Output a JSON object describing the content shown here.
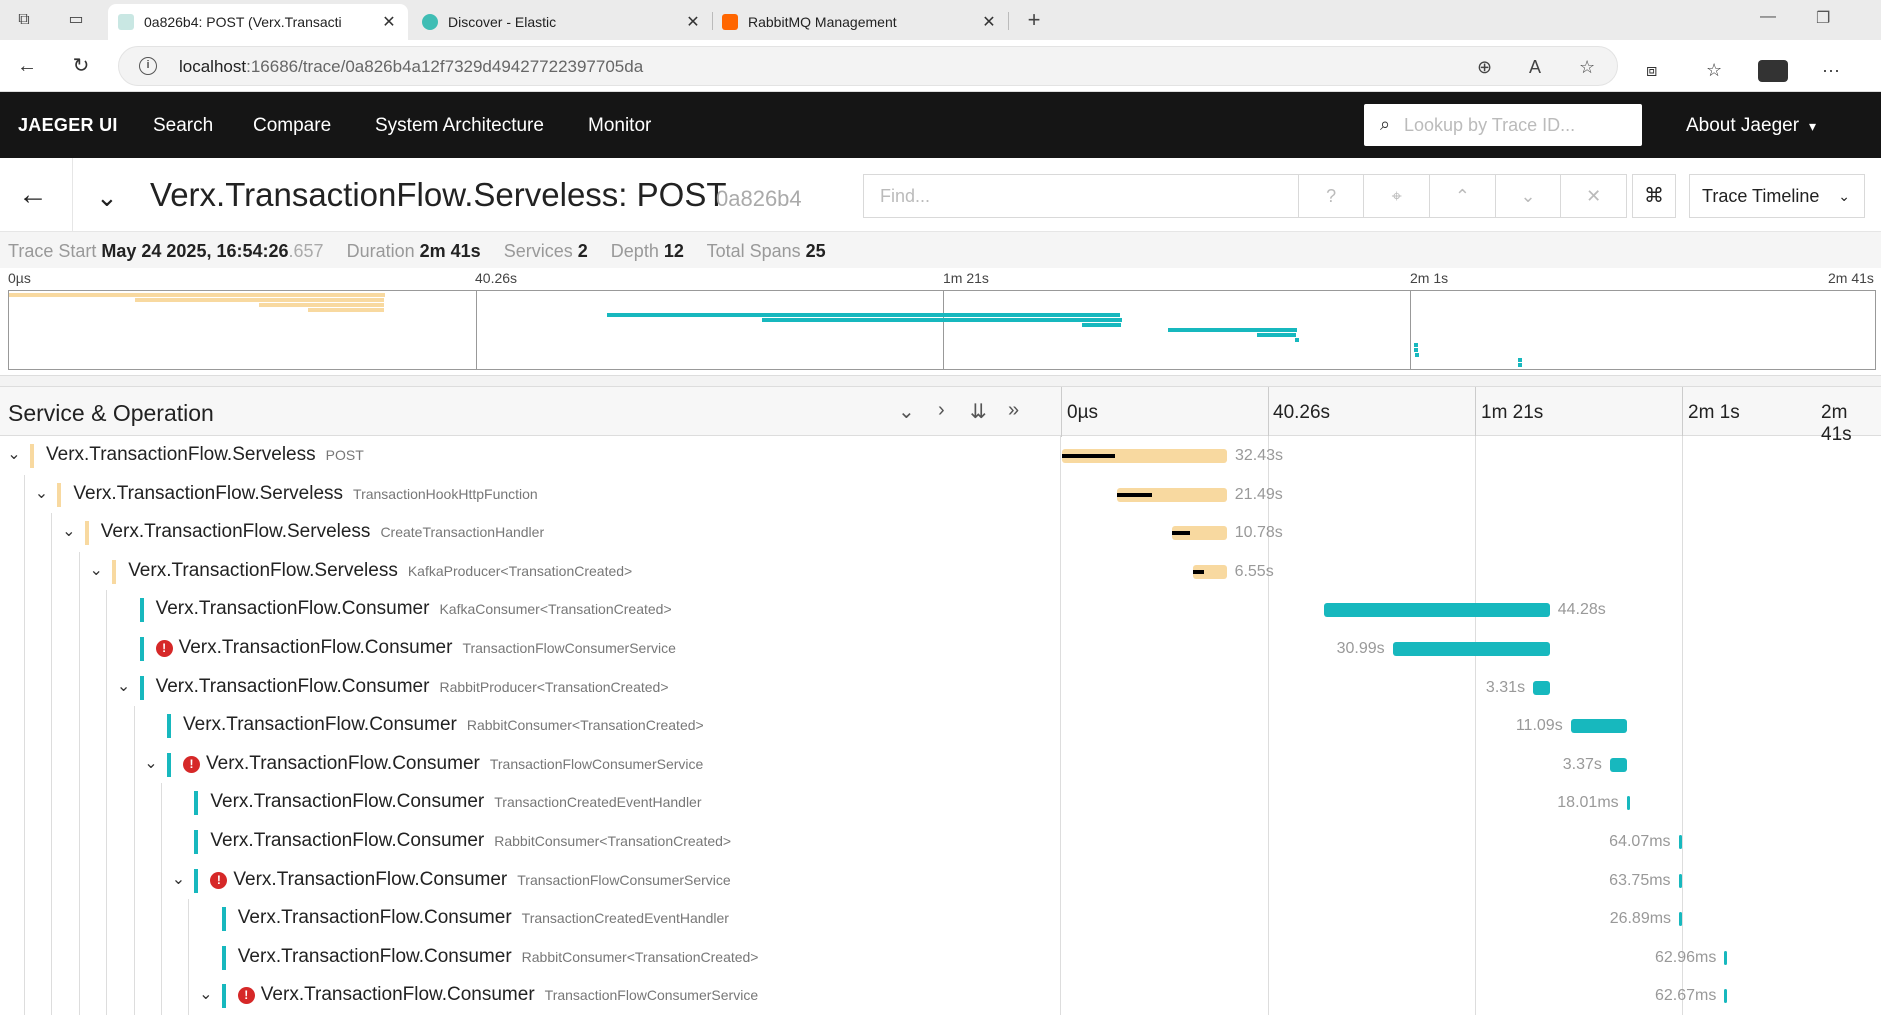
{
  "browser": {
    "tabs": [
      {
        "title": "0a826b4: POST (Verx.Transacti",
        "active": true,
        "color": "#c2185b"
      },
      {
        "title": "Discover - Elastic",
        "active": false,
        "color": "#3fbdb4"
      },
      {
        "title": "RabbitMQ Management",
        "active": false,
        "color": "#ff6600"
      }
    ],
    "url_host": "localhost",
    "url_path": ":16686/trace/0a826b4a12f7329d49427722397705da"
  },
  "jaeger_nav": {
    "brand": "JAEGER UI",
    "items": [
      "Search",
      "Compare",
      "System Architecture",
      "Monitor"
    ],
    "search_placeholder": "Lookup by Trace ID...",
    "about": "About Jaeger"
  },
  "trace": {
    "title": "Verx.TransactionFlow.Serveless: POST",
    "id_short": "0a826b4",
    "find_placeholder": "Find...",
    "view_select": "Trace Timeline",
    "summary": {
      "start_label": "Trace Start",
      "start_value": "May 24 2025, 16:54:26",
      "start_ms": ".657",
      "duration_label": "Duration",
      "duration_value": "2m 41s",
      "services_label": "Services",
      "services_value": "2",
      "depth_label": "Depth",
      "depth_value": "12",
      "spans_label": "Total Spans",
      "spans_value": "25"
    }
  },
  "minimap": {
    "ticks": [
      "0µs",
      "40.26s",
      "1m 21s",
      "2m 1s",
      "2m 41s"
    ]
  },
  "grid": {
    "column_header": "Service & Operation",
    "ticks": [
      "0µs",
      "40.26s",
      "1m 21s",
      "2m 1s",
      "2m 41s"
    ]
  },
  "colors": {
    "serveless": "#f8d9a0",
    "consumer": "#17b8be",
    "error": "#d62828"
  },
  "spans": [
    {
      "service": "Verx.TransactionFlow.Serveless",
      "operation": "POST",
      "depth": 0,
      "expandable": true,
      "error": false,
      "svc": "serveless",
      "start_s": 0.0,
      "dur_s": 32.43,
      "duration": "32.43s",
      "label_side": "right"
    },
    {
      "service": "Verx.TransactionFlow.Serveless",
      "operation": "TransactionHookHttpFunction",
      "depth": 1,
      "expandable": true,
      "error": false,
      "svc": "serveless",
      "start_s": 10.9,
      "dur_s": 21.49,
      "duration": "21.49s",
      "label_side": "right"
    },
    {
      "service": "Verx.TransactionFlow.Serveless",
      "operation": "CreateTransactionHandler",
      "depth": 2,
      "expandable": true,
      "error": false,
      "svc": "serveless",
      "start_s": 21.6,
      "dur_s": 10.78,
      "duration": "10.78s",
      "label_side": "right"
    },
    {
      "service": "Verx.TransactionFlow.Serveless",
      "operation": "KafkaProducer<TransationCreated>",
      "depth": 3,
      "expandable": true,
      "error": false,
      "svc": "serveless",
      "start_s": 25.8,
      "dur_s": 6.55,
      "duration": "6.55s",
      "label_side": "right"
    },
    {
      "service": "Verx.TransactionFlow.Consumer",
      "operation": "KafkaConsumer<TransationCreated>",
      "depth": 4,
      "expandable": false,
      "error": false,
      "svc": "consumer",
      "start_s": 51.6,
      "dur_s": 44.28,
      "duration": "44.28s",
      "label_side": "right"
    },
    {
      "service": "Verx.TransactionFlow.Consumer",
      "operation": "TransactionFlowConsumerService",
      "depth": 4,
      "expandable": false,
      "error": true,
      "svc": "consumer",
      "start_s": 65.0,
      "dur_s": 30.99,
      "duration": "30.99s",
      "label_side": "left"
    },
    {
      "service": "Verx.TransactionFlow.Consumer",
      "operation": "RabbitProducer<TransationCreated>",
      "depth": 4,
      "expandable": true,
      "error": false,
      "svc": "consumer",
      "start_s": 92.6,
      "dur_s": 3.31,
      "duration": "3.31s",
      "label_side": "left"
    },
    {
      "service": "Verx.TransactionFlow.Consumer",
      "operation": "RabbitConsumer<TransationCreated>",
      "depth": 5,
      "expandable": false,
      "error": false,
      "svc": "consumer",
      "start_s": 100.0,
      "dur_s": 11.09,
      "duration": "11.09s",
      "label_side": "left"
    },
    {
      "service": "Verx.TransactionFlow.Consumer",
      "operation": "TransactionFlowConsumerService",
      "depth": 5,
      "expandable": true,
      "error": true,
      "svc": "consumer",
      "start_s": 107.7,
      "dur_s": 3.37,
      "duration": "3.37s",
      "label_side": "left"
    },
    {
      "service": "Verx.TransactionFlow.Consumer",
      "operation": "TransactionCreatedEventHandler",
      "depth": 6,
      "expandable": false,
      "error": false,
      "svc": "consumer",
      "start_s": 111.0,
      "dur_s": 0.018,
      "duration": "18.01ms",
      "label_side": "left"
    },
    {
      "service": "Verx.TransactionFlow.Consumer",
      "operation": "RabbitConsumer<TransationCreated>",
      "depth": 6,
      "expandable": false,
      "error": false,
      "svc": "consumer",
      "start_s": 121.2,
      "dur_s": 0.064,
      "duration": "64.07ms",
      "label_side": "left"
    },
    {
      "service": "Verx.TransactionFlow.Consumer",
      "operation": "TransactionFlowConsumerService",
      "depth": 6,
      "expandable": true,
      "error": true,
      "svc": "consumer",
      "start_s": 121.2,
      "dur_s": 0.064,
      "duration": "63.75ms",
      "label_side": "left"
    },
    {
      "service": "Verx.TransactionFlow.Consumer",
      "operation": "TransactionCreatedEventHandler",
      "depth": 7,
      "expandable": false,
      "error": false,
      "svc": "consumer",
      "start_s": 121.3,
      "dur_s": 0.027,
      "duration": "26.89ms",
      "label_side": "left"
    },
    {
      "service": "Verx.TransactionFlow.Consumer",
      "operation": "RabbitConsumer<TransationCreated>",
      "depth": 7,
      "expandable": false,
      "error": false,
      "svc": "consumer",
      "start_s": 130.2,
      "dur_s": 0.063,
      "duration": "62.96ms",
      "label_side": "left"
    },
    {
      "service": "Verx.TransactionFlow.Consumer",
      "operation": "TransactionFlowConsumerService",
      "depth": 7,
      "expandable": true,
      "error": true,
      "svc": "consumer",
      "start_s": 130.2,
      "dur_s": 0.063,
      "duration": "62.67ms",
      "label_side": "left"
    }
  ]
}
